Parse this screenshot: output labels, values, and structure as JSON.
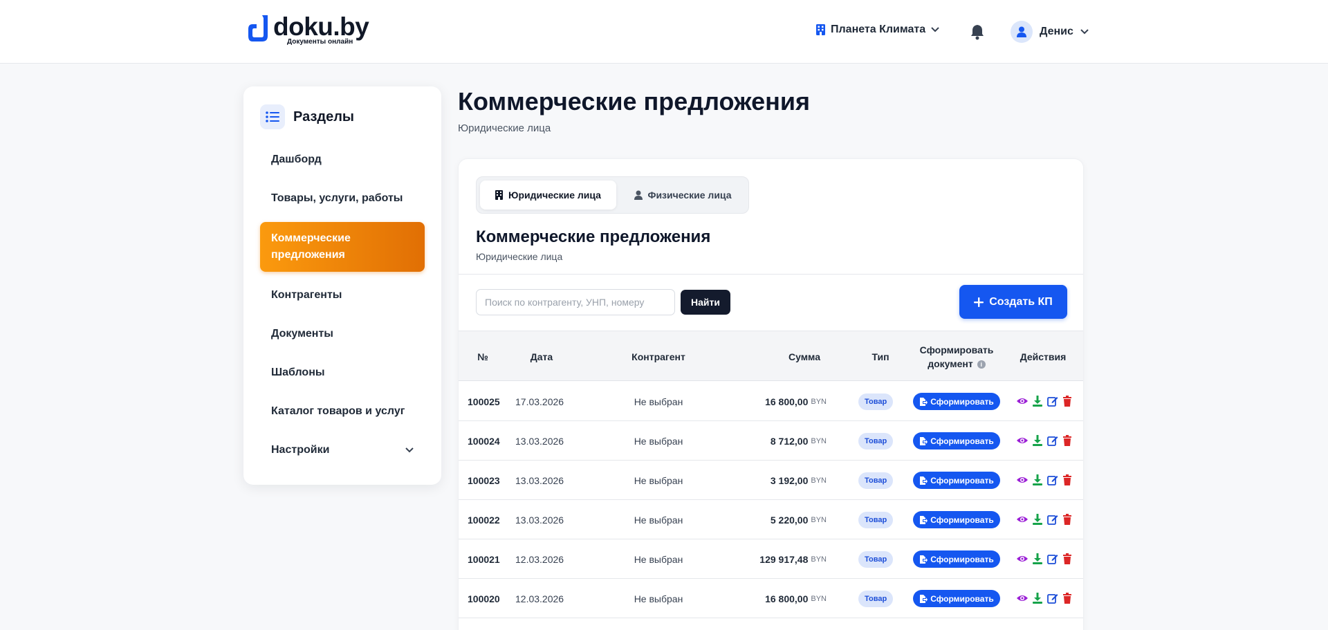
{
  "header": {
    "logo_title": "doku.by",
    "logo_subtitle": "Документы онлайн",
    "company": "Планета Климата",
    "user": "Денис",
    "icons": [
      "building-icon",
      "chevron-down-icon",
      "bell-icon",
      "user-icon"
    ]
  },
  "sidebar": {
    "title": "Разделы",
    "items": [
      {
        "label": "Дашборд"
      },
      {
        "label": "Товары, услуги, работы"
      },
      {
        "label": "Коммерческие предложения",
        "active": true
      },
      {
        "label": "Контрагенты"
      },
      {
        "label": "Документы"
      },
      {
        "label": "Шаблоны"
      },
      {
        "label": "Каталог товаров и услуг"
      },
      {
        "label": "Настройки"
      }
    ]
  },
  "main": {
    "title": "Коммерческие предложения",
    "subtitle": "Юридические лица"
  },
  "card": {
    "tabs": [
      {
        "label": "Юридические лица",
        "active": true
      },
      {
        "label": "Физические лица"
      }
    ],
    "title": "Коммерческие предложения",
    "subtitle": "Юридические лица",
    "search_placeholder": "Поиск по контрагенту, УНП, номеру",
    "search_value": "",
    "find_label": "Найти",
    "create_label": "Создать КП"
  },
  "table": {
    "headers": {
      "num": "№",
      "date": "Дата",
      "counterparty": "Контрагент",
      "sum": "Сумма",
      "type": "Тип",
      "generate_line1": "Сформировать",
      "generate_line2": "документ",
      "actions": "Действия"
    },
    "generate_btn": "Сформировать",
    "rows": [
      {
        "num": "100025",
        "date": "17.03.2026",
        "counterparty": "Не выбран",
        "sum": "16 800,00",
        "currency": "BYN",
        "type": "Товар"
      },
      {
        "num": "100024",
        "date": "13.03.2026",
        "counterparty": "Не выбран",
        "sum": "8 712,00",
        "currency": "BYN",
        "type": "Товар"
      },
      {
        "num": "100023",
        "date": "13.03.2026",
        "counterparty": "Не выбран",
        "sum": "3 192,00",
        "currency": "BYN",
        "type": "Товар"
      },
      {
        "num": "100022",
        "date": "13.03.2026",
        "counterparty": "Не выбран",
        "sum": "5 220,00",
        "currency": "BYN",
        "type": "Товар"
      },
      {
        "num": "100021",
        "date": "12.03.2026",
        "counterparty": "Не выбран",
        "sum": "129 917,48",
        "currency": "BYN",
        "type": "Товар"
      },
      {
        "num": "100020",
        "date": "12.03.2026",
        "counterparty": "Не выбран",
        "sum": "16 800,00",
        "currency": "BYN",
        "type": "Товар"
      }
    ]
  },
  "colors": {
    "accent": "#1557f0",
    "active_nav": "#f08a0a",
    "view": "#9b1fd6",
    "download": "#16a34a",
    "edit": "#1d4ed8",
    "delete": "#dc2626"
  }
}
